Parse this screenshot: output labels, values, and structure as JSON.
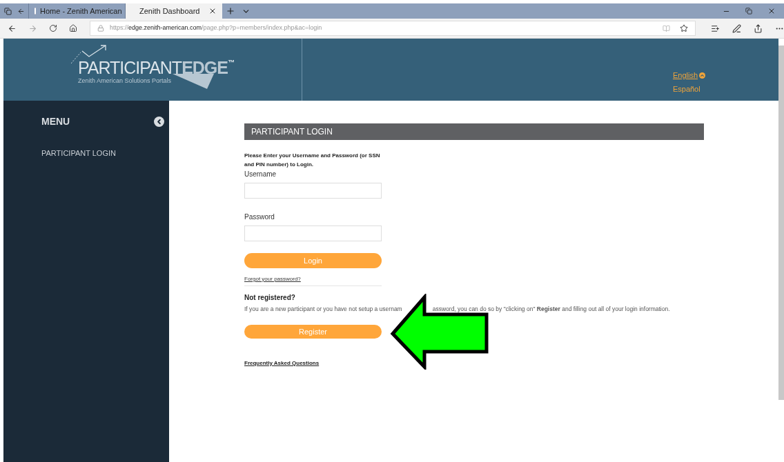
{
  "browser": {
    "tabs": [
      {
        "label": "Home - Zenith American",
        "selected": false
      },
      {
        "label": "Zenith Dashboard",
        "selected": true
      }
    ],
    "url": {
      "scheme": "https://",
      "host": "edge.zenith-american.com",
      "path": "/page.php?p=members/index.php&ac=login"
    }
  },
  "header": {
    "logo": {
      "light": "PARTICIPANT",
      "bold": "EDGE",
      "tm": "™",
      "tagline": "Zenith American Solutions Portals"
    },
    "languages": [
      {
        "label": "English",
        "selected": true
      },
      {
        "label": "Español",
        "selected": false
      }
    ]
  },
  "sidebar": {
    "title": "MENU",
    "items": [
      {
        "label": "PARTICIPANT LOGIN"
      }
    ]
  },
  "login": {
    "title": "PARTICIPANT LOGIN",
    "instructions": "Please Enter your Username and Password (or SSN and PIN number) to Login.",
    "fields": [
      {
        "label": "Username"
      },
      {
        "label": "Password"
      }
    ],
    "login_button": "Login",
    "forgot_link": "Forgot your password?",
    "not_registered": "Not registered?",
    "register_text": [
      "If you are a new participant or you have not setup a usernam",
      "assword, you can do so by \"clicking on\" **Register** and filling out all of your login information."
    ],
    "register_button": "Register",
    "faq_link": "Frequently Asked Questions"
  },
  "annotation": {
    "kind": "arrow",
    "color": "#00ff00"
  }
}
